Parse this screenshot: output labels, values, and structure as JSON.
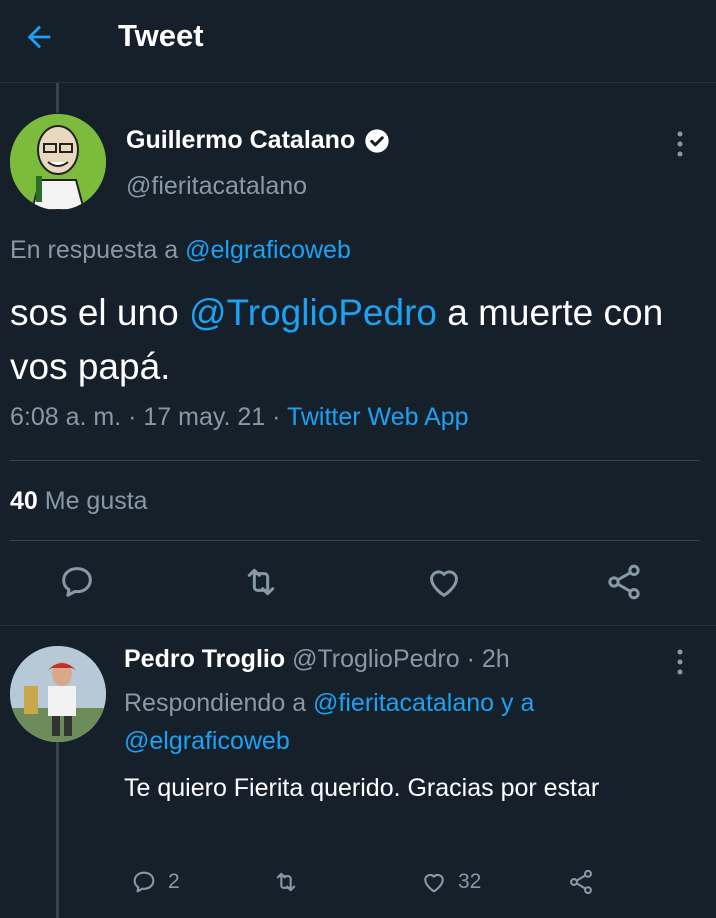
{
  "header": {
    "title": "Tweet",
    "back_icon": "arrow-left-icon"
  },
  "colors": {
    "background": "#15202b",
    "accent": "#1da1f2",
    "muted": "#8899a6",
    "divider": "#38444d"
  },
  "main_tweet": {
    "author_name": "Guillermo Catalano",
    "author_handle": "@fieritacatalano",
    "verified": true,
    "reply_prefix": "En respuesta a ",
    "reply_to": "@elgraficoweb",
    "text_part1": "sos el uno ",
    "mention": "@TroglioPedro",
    "text_part2": " a muerte con vos papá.",
    "time": "6:08 a. m. · 17 may. 21 · ",
    "source": "Twitter Web App",
    "likes_count": "40",
    "likes_label": " Me gusta"
  },
  "reply_tweet": {
    "author_name": "Pedro Troglio",
    "author_handle": " @TroglioPedro · 2h",
    "replying_prefix": "Respondiendo a ",
    "replying_user1": "@fieritacatalano",
    "replying_and": " y a ",
    "replying_user2": "@elgraficoweb",
    "text": "Te quiero Fierita querido. Gracias por estar",
    "reply_count": "2",
    "like_count": "32"
  }
}
